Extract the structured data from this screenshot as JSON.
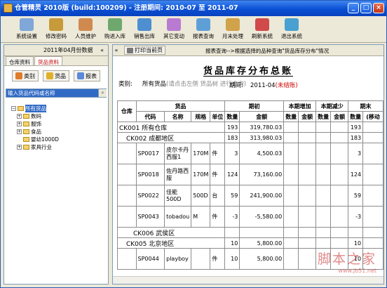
{
  "window": {
    "title": "仓管精灵 2010版 (build:100209) - 注册期间: 2010-07 至 2011-07"
  },
  "toolbar": [
    {
      "label": "系统设置",
      "icon": "settings-icon",
      "color": "#7fa7d8"
    },
    {
      "label": "修改密码",
      "icon": "key-icon",
      "color": "#c79a3a"
    },
    {
      "label": "人员维护",
      "icon": "users-icon",
      "color": "#d08a50"
    },
    {
      "label": "购进入库",
      "icon": "inbound-icon",
      "color": "#6fa86f"
    },
    {
      "label": "销售出库",
      "icon": "outbound-icon",
      "color": "#4d8fd1"
    },
    {
      "label": "其它变动",
      "icon": "transfer-icon",
      "color": "#b87bd1"
    },
    {
      "label": "报表查询",
      "icon": "report-icon",
      "color": "#5f9fd8"
    },
    {
      "label": "月末处理",
      "icon": "calendar-icon",
      "color": "#d0a24a"
    },
    {
      "label": "刷新系统",
      "icon": "refresh-icon",
      "color": "#d04a4a"
    },
    {
      "label": "退出系统",
      "icon": "exit-icon",
      "color": "#4aa0d0"
    }
  ],
  "left": {
    "period": "2011年04月份数据",
    "collapse": "«",
    "tabs": [
      "仓库资料",
      "货品资料"
    ],
    "buttons": [
      {
        "label": "类别",
        "color": "#e07b2a"
      },
      {
        "label": "货品",
        "color": "#e0b02a"
      },
      {
        "label": "报表",
        "color": "#5a8ad8"
      }
    ],
    "search_text": "输入货品代码或名称",
    "tree": [
      {
        "label": "所有货品",
        "selected": true,
        "exp": "−"
      },
      {
        "label": "数码",
        "selected": false,
        "exp": "+"
      },
      {
        "label": "服饰",
        "selected": false,
        "exp": "+"
      },
      {
        "label": "食品",
        "selected": false,
        "exp": "+"
      },
      {
        "label": "婴幼1000D",
        "selected": false,
        "exp": ""
      },
      {
        "label": "家具行业",
        "selected": false,
        "exp": "+"
      }
    ]
  },
  "right": {
    "nav": "«",
    "print_label": "打印当前页",
    "query_hint": "报表查询-->根据选择的品种查询\"货品库存分布\"情况",
    "report_title": "货品库存分布总账",
    "category_label": "类别:",
    "category_value": "所有货品",
    "category_hint": "(请点击左侧 货品树 进行查询)",
    "period_label": "期间:",
    "period_value": "2011-04",
    "unposted": "(未结账)",
    "headers": {
      "warehouse": "仓库",
      "goods": "货品",
      "opening": "期初",
      "increase": "本期增加",
      "decrease": "本期减少",
      "closing": "期末",
      "code": "代码",
      "name": "名称",
      "spec": "规格",
      "unit": "单位",
      "qty": "数量",
      "amount": "金额",
      "closing_amount": "(移动"
    },
    "rows": [
      {
        "type": "wh",
        "label": "CK001 所有仓库",
        "indent": 0,
        "qty": "193",
        "amount": "319,780.03",
        "cqty": "193"
      },
      {
        "type": "wh",
        "label": "CK002 成都地区",
        "indent": 1,
        "qty": "183",
        "amount": "313,980.03",
        "cqty": "183"
      },
      {
        "type": "item",
        "code": "SP0017",
        "name": "皮尔卡丹西服1",
        "spec": "170M",
        "unit": "件",
        "qty": "3",
        "amount": "4,500.03",
        "cqty": "3"
      },
      {
        "type": "item",
        "code": "SP0018",
        "name": "佐丹路西服",
        "spec": "170M",
        "unit": "件",
        "qty": "124",
        "amount": "73,160.00",
        "cqty": "124"
      },
      {
        "type": "item",
        "code": "SP0022",
        "name": "佳能500D",
        "spec": "500D",
        "unit": "台",
        "qty": "59",
        "amount": "241,900.00",
        "cqty": "59"
      },
      {
        "type": "item",
        "code": "SP0043",
        "name": "tobadou",
        "spec": "M",
        "unit": "件",
        "qty": "-3",
        "amount": "-5,580.00",
        "cqty": "-3"
      },
      {
        "type": "wh",
        "label": "CK006 武侯区",
        "indent": 2,
        "qty": "",
        "amount": "",
        "cqty": ""
      },
      {
        "type": "wh",
        "label": "CK005 北京地区",
        "indent": 1,
        "qty": "10",
        "amount": "5,800.00",
        "cqty": "10"
      },
      {
        "type": "item",
        "code": "SP0044",
        "name": "playboy",
        "spec": "",
        "unit": "件",
        "qty": "10",
        "amount": "5,800.00",
        "cqty": "10"
      }
    ],
    "watermark_1": "脚本之家",
    "watermark_2": "www.jb51.net"
  }
}
